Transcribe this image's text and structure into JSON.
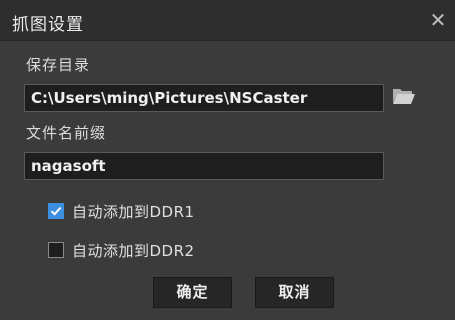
{
  "window": {
    "title": "抓图设置",
    "close_symbol": "✕"
  },
  "save_dir": {
    "label": "保存目录",
    "value": "C:\\Users\\ming\\Pictures\\NSCaster",
    "browse_icon": "folder-open-icon"
  },
  "prefix": {
    "label": "文件名前缀",
    "value": "nagasoft"
  },
  "options": [
    {
      "label": "自动添加到DDR1",
      "checked": true
    },
    {
      "label": "自动添加到DDR2",
      "checked": false
    }
  ],
  "buttons": {
    "ok": "确定",
    "cancel": "取消"
  },
  "colors": {
    "background": "#3b3b3b",
    "titlebar": "#2e2e2e",
    "field": "#1e1e1e",
    "checkbox_accent": "#3d8fe0",
    "folder_icon": "#c8c8c8"
  }
}
